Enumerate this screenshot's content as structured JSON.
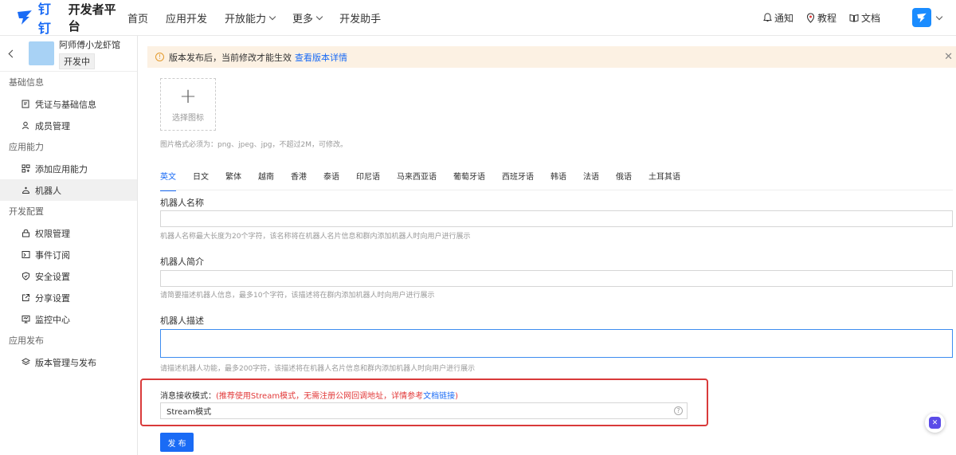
{
  "topnav": {
    "brand_name": "钉钉",
    "brand_sub": "开发者平台",
    "items": [
      "首页",
      "应用开发",
      "开放能力",
      "更多",
      "开发助手"
    ],
    "right": {
      "notify": "通知",
      "tutorial": "教程",
      "docs": "文档"
    }
  },
  "sidebar": {
    "app_name": "阿师傅小龙虾馆",
    "app_status": "开发中",
    "sections": [
      {
        "title": "基础信息",
        "items": [
          "凭证与基础信息",
          "成员管理"
        ]
      },
      {
        "title": "应用能力",
        "items": [
          "添加应用能力",
          "机器人"
        ]
      },
      {
        "title": "开发配置",
        "items": [
          "权限管理",
          "事件订阅",
          "安全设置",
          "分享设置",
          "监控中心"
        ]
      },
      {
        "title": "应用发布",
        "items": [
          "版本管理与发布"
        ]
      }
    ],
    "active_item": "机器人"
  },
  "notice": {
    "text": "版本发布后，当前修改才能生效",
    "link": "查看版本详情"
  },
  "icon_upload": {
    "label": "选择图标",
    "hint": "图片格式必须为：png、jpeg、jpg，不超过2M，可修改。"
  },
  "lang_tabs": [
    "英文",
    "日文",
    "繁体",
    "越南",
    "香港",
    "泰语",
    "印尼语",
    "马来西亚语",
    "葡萄牙语",
    "西班牙语",
    "韩语",
    "法语",
    "俄语",
    "土耳其语"
  ],
  "fields": {
    "name": {
      "label": "机器人名称",
      "hint": "机器人名称最大长度为20个字符，该名称将在机器人名片信息和群内添加机器人时向用户进行展示",
      "value": ""
    },
    "intro": {
      "label": "机器人简介",
      "hint": "请简要描述机器人信息，最多10个字符，该描述将在群内添加机器人时向用户进行展示",
      "value": ""
    },
    "desc": {
      "label": "机器人描述",
      "hint": "请描述机器人功能，最多200字符，该描述将在机器人名片信息和群内添加机器人时向用户进行展示",
      "value": ""
    }
  },
  "message_mode": {
    "label": "消息接收模式：",
    "tip": "(推荐使用Stream模式，无需注册公网回调地址，详情参考",
    "link": "文档链接",
    "tip_end": ")",
    "selected": "Stream模式"
  },
  "publish_label": "发 布",
  "colors": {
    "accent": "#1a6bf5",
    "warning_bg": "#fcf1e3",
    "highlight_frame": "#d93a3a"
  }
}
